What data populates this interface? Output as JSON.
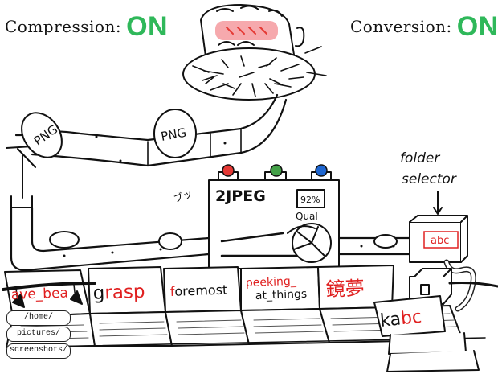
{
  "header": {
    "compression_label": "Compression:",
    "compression_state": "ON",
    "conversion_label": "Conversion:",
    "conversion_state": "ON"
  },
  "colors": {
    "on_green": "#2fb85a",
    "accent_red": "#e02020",
    "lamp_red": "#e53935",
    "lamp_green": "#43a047",
    "lamp_blue": "#1e66d0",
    "ink": "#111111"
  },
  "pipeline": {
    "egg_left": "PNG",
    "egg_right": "PNG",
    "converter_title": "2JPEG",
    "quality_value": "92%",
    "quality_label": "Qual",
    "machine_noise": "ブッ"
  },
  "folder_selector": {
    "label_line1": "folder",
    "label_line2": "selector",
    "display_value": "abc"
  },
  "laptops": [
    {
      "prefix": "",
      "red": "ave_bea",
      "suffix": ""
    },
    {
      "prefix": "g",
      "red": "rasp",
      "suffix": ""
    },
    {
      "prefix": "",
      "red": "f",
      "suffix": "oremost"
    },
    {
      "prefix": "",
      "red": "peeking_",
      "suffix": "at_things"
    },
    {
      "prefix": "",
      "red": "鏡夢",
      "suffix": ""
    }
  ],
  "last_screen": {
    "prefix": "ka",
    "red": "bc"
  },
  "folders": {
    "items": [
      "/home/",
      "pictures/",
      "screenshots/"
    ]
  }
}
